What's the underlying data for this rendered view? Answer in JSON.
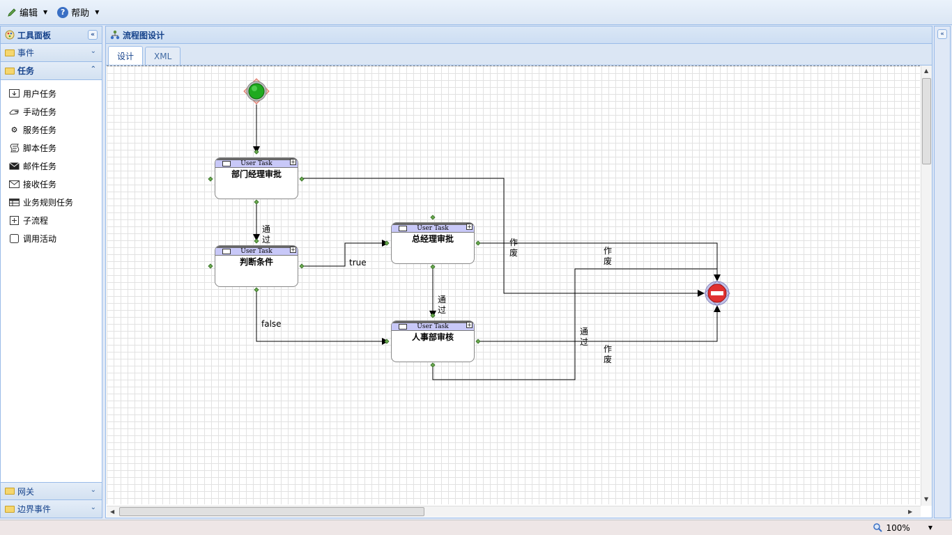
{
  "toolbar": {
    "edit_label": "编辑",
    "help_label": "帮助"
  },
  "left_panel": {
    "title": "工具面板",
    "events_label": "事件",
    "tasks_label": "任务",
    "task_items": [
      {
        "label": "用户任务",
        "icon": "user-task-icon"
      },
      {
        "label": "手动任务",
        "icon": "hand-icon"
      },
      {
        "label": "服务任务",
        "icon": "gear-icon"
      },
      {
        "label": "脚本任务",
        "icon": "script-icon"
      },
      {
        "label": "邮件任务",
        "icon": "mail-filled-icon"
      },
      {
        "label": "接收任务",
        "icon": "mail-outline-icon"
      },
      {
        "label": "业务规则任务",
        "icon": "table-icon"
      },
      {
        "label": "子流程",
        "icon": "plus-box-icon"
      },
      {
        "label": "调用活动",
        "icon": "rounded-box-icon"
      }
    ],
    "gateway_label": "网关",
    "boundary_label": "边界事件"
  },
  "main": {
    "title": "流程图设计",
    "tabs": [
      {
        "label": "设计"
      },
      {
        "label": "XML"
      }
    ]
  },
  "diagram": {
    "task_type_label": "User Task",
    "nodes": [
      {
        "id": "dept",
        "name": "部门经理审批"
      },
      {
        "id": "cond",
        "name": "判断条件"
      },
      {
        "id": "gm",
        "name": "总经理审批"
      },
      {
        "id": "hr",
        "name": "人事部审核"
      }
    ],
    "flow_labels": {
      "pass1": "通过",
      "true": "true",
      "false": "false",
      "pass2": "通过",
      "void1": "作废",
      "void2": "作废",
      "pass3": "通过",
      "void3": "作废"
    }
  },
  "status": {
    "zoom": "100%"
  }
}
